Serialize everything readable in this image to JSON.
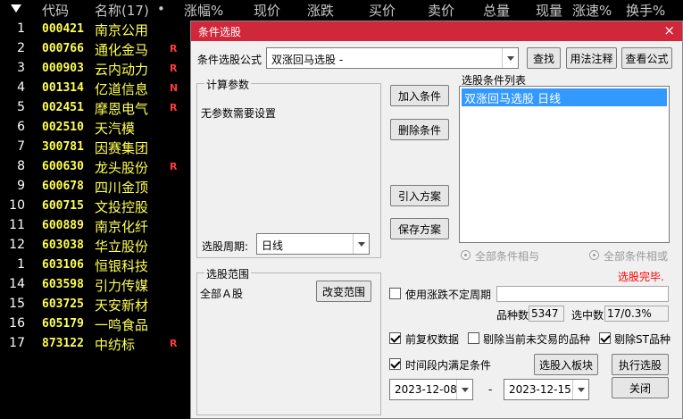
{
  "header": {
    "cols": [
      "代码",
      "名称(17)",
      "•",
      "涨幅%",
      "现价",
      "涨跌",
      "买价",
      "卖价",
      "总量",
      "现量",
      "涨速%",
      "换手%"
    ]
  },
  "stocks": [
    {
      "no": "1",
      "code": "000421",
      "name": "南京公用",
      "flag": ""
    },
    {
      "no": "2",
      "code": "000766",
      "name": "通化金马",
      "flag": "R"
    },
    {
      "no": "3",
      "code": "000903",
      "name": "云内动力",
      "flag": "R"
    },
    {
      "no": "4",
      "code": "001314",
      "name": "亿道信息",
      "flag": "N"
    },
    {
      "no": "5",
      "code": "002451",
      "name": "摩恩电气",
      "flag": "R"
    },
    {
      "no": "6",
      "code": "002510",
      "name": "天汽模",
      "flag": ""
    },
    {
      "no": "7",
      "code": "300781",
      "name": "因赛集团",
      "flag": ""
    },
    {
      "no": "8",
      "code": "600630",
      "name": "龙头股份",
      "flag": "R"
    },
    {
      "no": "9",
      "code": "600678",
      "name": "四川金顶",
      "flag": ""
    },
    {
      "no": "10",
      "code": "600715",
      "name": "文投控股",
      "flag": ""
    },
    {
      "no": "11",
      "code": "600889",
      "name": "南京化纤",
      "flag": ""
    },
    {
      "no": "12",
      "code": "603038",
      "name": "华立股份",
      "flag": ""
    },
    {
      "no": "1",
      "code": "603106",
      "name": "恒银科技",
      "flag": ""
    },
    {
      "no": "14",
      "code": "603598",
      "name": "引力传媒",
      "flag": ""
    },
    {
      "no": "15",
      "code": "603725",
      "name": "天安新材",
      "flag": ""
    },
    {
      "no": "16",
      "code": "605179",
      "name": "一鸣食品",
      "flag": ""
    },
    {
      "no": "17",
      "code": "873122",
      "name": "中纺标",
      "flag": "R"
    }
  ],
  "dialog": {
    "title": "条件选股",
    "close": "×",
    "formula_label": "条件选股公式",
    "formula_value": "双涨回马选股 -",
    "find": "查找",
    "usage": "用法注释",
    "view": "查看公式",
    "params_title": "计算参数",
    "params_text": "无参数需要设置",
    "period_label": "选股周期:",
    "period_value": "日线",
    "add": "加入条件",
    "delete": "删除条件",
    "import": "引入方案",
    "save": "保存方案",
    "list_title": "选股条件列表",
    "list_item": "双涨回马选股  日线",
    "radio_and": "全部条件相与",
    "radio_or": "全部条件相或",
    "done": "选股完毕.",
    "range_title": "选股范围",
    "range_value": "全部Ａ股",
    "change_range": "改变范围",
    "use_period": "使用涨跌不定周期",
    "count_label": "品种数",
    "count_value": "5347",
    "hit_label": "选中数",
    "hit_value": "17/0.3%",
    "pre_adjust": "前复权数据",
    "exclude_untraded": "剔除当前未交易的品种",
    "exclude_st": "剔除ST品种",
    "time_range": "时间段内满足条件",
    "to_block": "选股入板块",
    "execute": "执行选股",
    "date_from": "2023-12-08",
    "dash": "-",
    "date_to": "2023-12-15",
    "close_btn": "关闭"
  },
  "colors": {
    "title_bar": "#d0283a",
    "code": "#ffff54",
    "flag": "#ff3b3b",
    "selection": "#3399ff",
    "done_text": "#ff0000"
  }
}
